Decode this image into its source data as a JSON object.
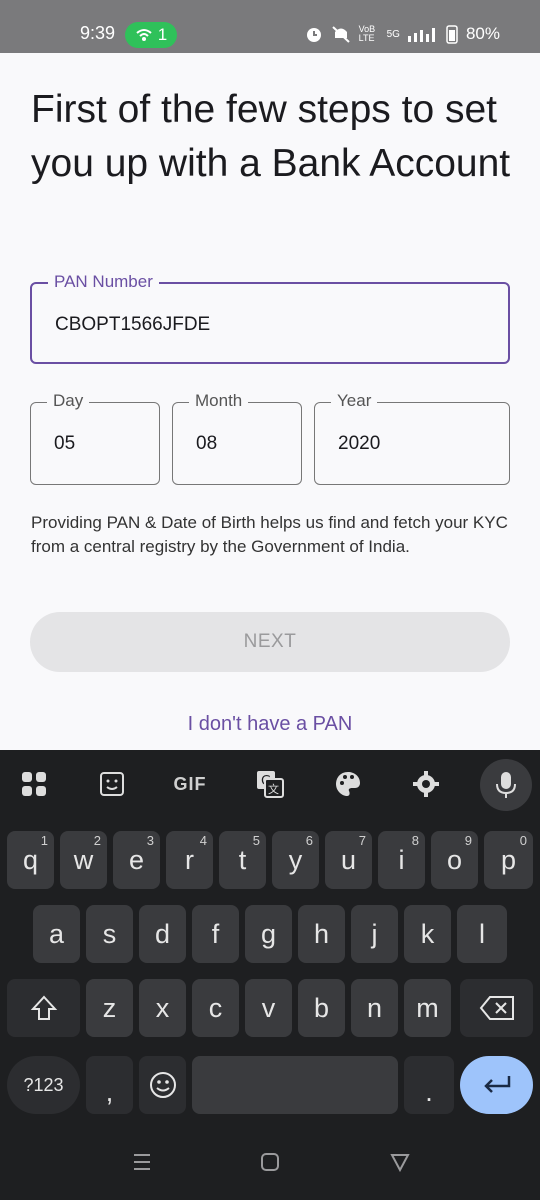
{
  "status_bar": {
    "time": "9:39",
    "hotspot_count": "1",
    "network": "VoB LTE",
    "signal": "5G",
    "battery": "80%"
  },
  "page": {
    "heading": "First of the few steps to set you up with a Bank Account",
    "pan": {
      "label": "PAN Number",
      "value": "CBOPT1566JFDE"
    },
    "dob": {
      "day": {
        "label": "Day",
        "value": "05"
      },
      "month": {
        "label": "Month",
        "value": "08"
      },
      "year": {
        "label": "Year",
        "value": "2020"
      }
    },
    "info_text": "Providing PAN & Date of Birth helps us find and fetch your KYC from a central registry by the Government of India.",
    "next_label": "NEXT",
    "no_pan_link": "I don't have a PAN"
  },
  "keyboard": {
    "toolbar": {
      "gif_label": "GIF"
    },
    "row1": [
      {
        "k": "q",
        "h": "1"
      },
      {
        "k": "w",
        "h": "2"
      },
      {
        "k": "e",
        "h": "3"
      },
      {
        "k": "r",
        "h": "4"
      },
      {
        "k": "t",
        "h": "5"
      },
      {
        "k": "y",
        "h": "6"
      },
      {
        "k": "u",
        "h": "7"
      },
      {
        "k": "i",
        "h": "8"
      },
      {
        "k": "o",
        "h": "9"
      },
      {
        "k": "p",
        "h": "0"
      }
    ],
    "row2": [
      "a",
      "s",
      "d",
      "f",
      "g",
      "h",
      "j",
      "k",
      "l"
    ],
    "row3": [
      "z",
      "x",
      "c",
      "v",
      "b",
      "n",
      "m"
    ],
    "symbols_label": "?123",
    "comma": ",",
    "period": "."
  },
  "colors": {
    "accent": "#6a4fa3",
    "enter": "#9ec4fb",
    "hotspot": "#2fc15a"
  }
}
